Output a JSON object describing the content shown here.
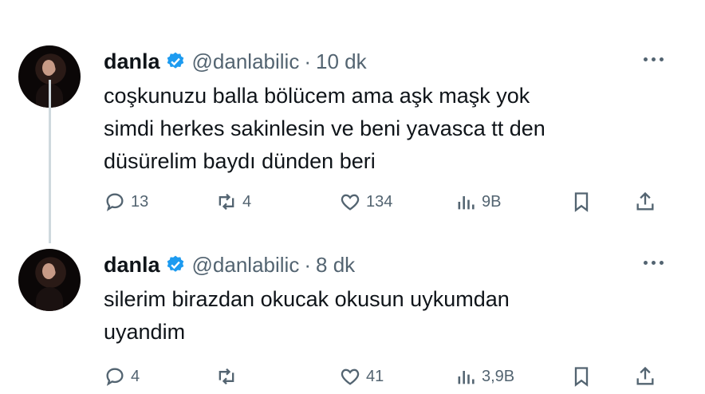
{
  "tweets": [
    {
      "name": "danla",
      "handle": "@danlabilic",
      "separator": "·",
      "time": "10 dk",
      "lines": [
        "coşkunuzu balla bölücem ama aşk maşk yok",
        "simdi herkes sakinlesin ve beni yavasca tt den",
        "düsürelim baydı dünden beri"
      ],
      "replies": "13",
      "retweets": "4",
      "likes": "134",
      "views": "9B"
    },
    {
      "name": "danla",
      "handle": "@danlabilic",
      "separator": "·",
      "time": "8 dk",
      "lines": [
        "silerim birazdan okucak okusun uykumdan",
        "uyandim"
      ],
      "replies": "4",
      "retweets": "",
      "likes": "41",
      "views": "3,9B"
    }
  ],
  "colors": {
    "verified": "#1d9bf0",
    "secondary_text": "#536471",
    "thread_line": "#cfd9de"
  },
  "icons": [
    "reply-icon",
    "retweet-icon",
    "like-icon",
    "views-icon",
    "bookmark-icon",
    "share-icon",
    "more-icon",
    "verified-icon"
  ]
}
